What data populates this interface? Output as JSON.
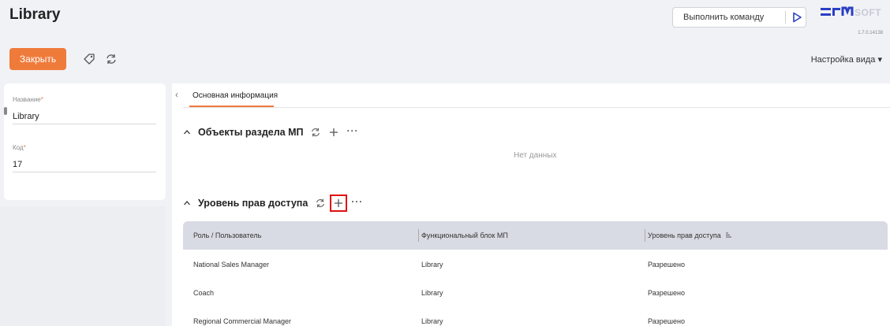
{
  "header": {
    "title": "Library",
    "command_placeholder": "Выполнить команду",
    "logo_text": "BPMSOFT",
    "version": "1.7.0.14138"
  },
  "toolbar": {
    "close_label": "Закрыть",
    "view_settings_label": "Настройка вида ▾"
  },
  "left_panel": {
    "name_label": "Название",
    "name_value": "Library",
    "code_label": "Код",
    "code_value": "17",
    "required_mark": "*"
  },
  "tabs": [
    {
      "label": "Основная информация",
      "active": true
    }
  ],
  "sections": {
    "objects": {
      "title": "Объекты раздела МП",
      "empty_text": "Нет данных"
    },
    "access": {
      "title": "Уровень прав доступа",
      "columns": [
        "Роль / Пользователь",
        "Функциональный блок МП",
        "Уровень прав доступа"
      ],
      "rows": [
        [
          "National Sales Manager",
          "Library",
          "Разрешено"
        ],
        [
          "Coach",
          "Library",
          "Разрешено"
        ],
        [
          "Regional Commercial Manager",
          "Library",
          "Разрешено"
        ]
      ]
    }
  },
  "colors": {
    "accent": "#ef7b3b",
    "highlight": "#e01010",
    "logo_blue": "#2a3fc4"
  },
  "icons": {
    "run": "play-triangle-icon",
    "tag": "tag-icon",
    "refresh": "refresh-icon",
    "add": "plus-icon",
    "more": "more-dots-icon",
    "collapse": "chevron-up-icon",
    "sort": "sort-icon"
  }
}
